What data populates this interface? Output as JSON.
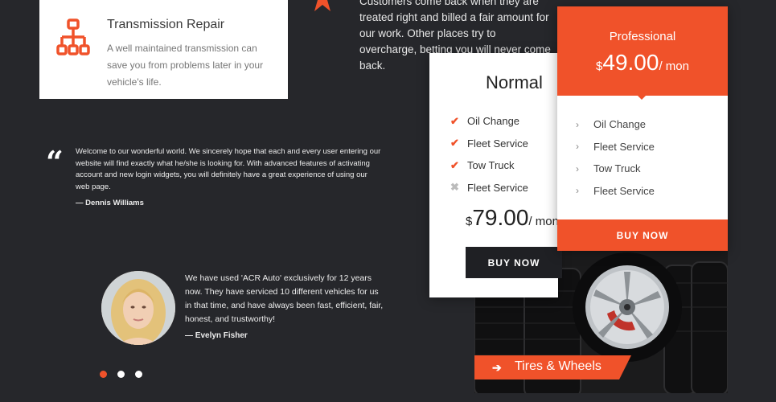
{
  "service": {
    "title": "Transmission Repair",
    "text": "A well maintained transmission can save you from problems later in your vehicle's life.",
    "icon": "network-icon"
  },
  "top_text": "Customers come back when they are treated right and billed a fair amount for our work. Other places try to overcharge, betting you will never come back.",
  "quote": {
    "text": "Welcome to our wonderful world. We sincerely hope that each and every user entering our website will find exactly what he/she is looking for. With advanced features of activating account and new login widgets, you will definitely have a great experience of using our web page.",
    "author": "— Dennis Williams"
  },
  "testimonial": {
    "text": "We have used 'ACR Auto' exclusively for 12 years now. They have serviced 10 different vehicles for us in that time, and have always been fast, efficient, fair, honest, and trustworthy!",
    "author": "— Evelyn Fisher",
    "dots": 3,
    "active_dot": 0
  },
  "tires": {
    "label": "Tires & Wheels"
  },
  "normal_plan": {
    "title": "Normal",
    "features": [
      {
        "label": "Oil Change",
        "included": true
      },
      {
        "label": "Fleet Service",
        "included": true
      },
      {
        "label": "Tow Truck",
        "included": true
      },
      {
        "label": "Fleet Service",
        "included": false
      }
    ],
    "currency": "$",
    "amount": "79.00",
    "period": "/ mon",
    "button": "BUY NOW"
  },
  "pro_plan": {
    "title": "Professional",
    "features": [
      "Oil Change",
      "Fleet Service",
      "Tow Truck",
      "Fleet Service"
    ],
    "currency": "$",
    "amount": "49.00",
    "period": "/ mon",
    "button": "BUY NOW"
  },
  "colors": {
    "accent": "#f0522a",
    "background": "#26272b",
    "dark_button": "#1f2024"
  }
}
